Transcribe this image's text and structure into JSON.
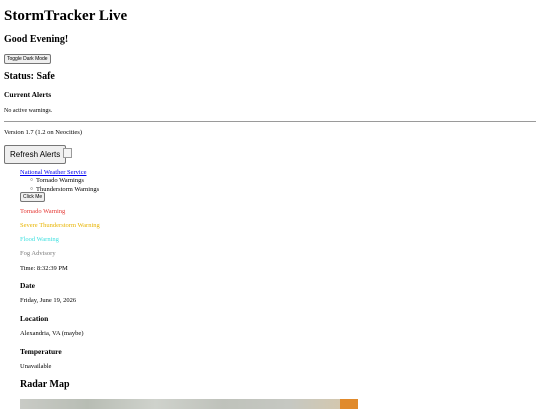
{
  "app": {
    "title": "StormTracker Live",
    "greeting": "Good Evening!"
  },
  "controls": {
    "toggle_dark_mode": "Toggle Dark Mode",
    "refresh_alerts": "Refresh Alerts",
    "click_me": "Click Me"
  },
  "status": {
    "label": "Status: Safe"
  },
  "alerts": {
    "heading": "Current Alerts",
    "message": "No active warnings."
  },
  "version": {
    "text": "Version 1.7 (1.2 on Neocities)"
  },
  "links": {
    "nws": "National Weather Service",
    "subitems": [
      "Tornado Warnings",
      "Thunderstorm Warnings"
    ]
  },
  "warnings": [
    {
      "label": "Tornado Warning",
      "color": "#e53935"
    },
    {
      "label": "Severe Thunderstorm Warning",
      "color": "#e8b400"
    },
    {
      "label": "Flood Warning",
      "color": "#3fe0e0"
    },
    {
      "label": "Fog Advisory",
      "color": "#7a7a7a"
    }
  ],
  "info": {
    "time": "Time: 8:32:39 PM",
    "date_heading": "Date",
    "date_value": "Friday, June 19, 2026",
    "location_heading": "Location",
    "location_value": "Alexandria, VA (maybe)",
    "temperature_heading": "Temperature",
    "temperature_value": "Unavailable"
  },
  "radar": {
    "heading": "Radar Map"
  }
}
